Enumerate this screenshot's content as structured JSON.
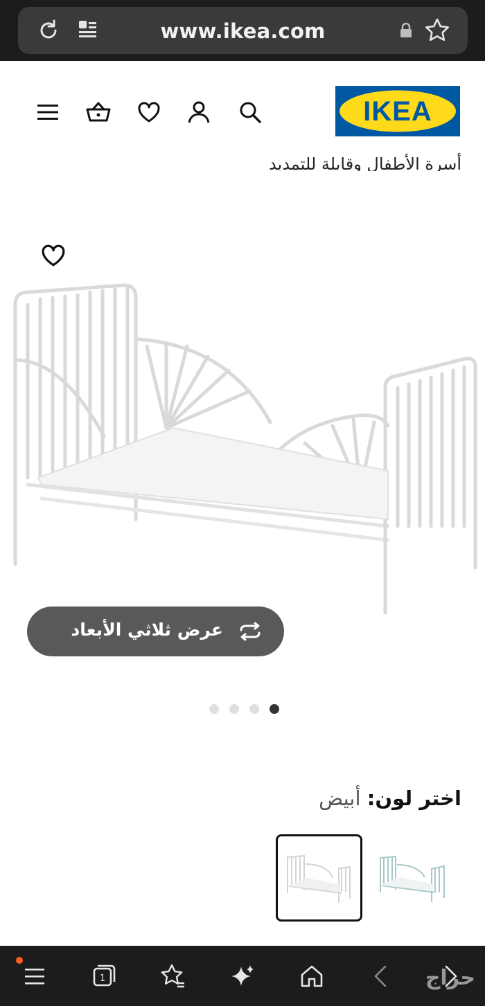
{
  "browser": {
    "url": "www.ikea.com",
    "icons": [
      "reload-icon",
      "reader-mode-icon",
      "lock-icon",
      "bookmark-star-icon"
    ]
  },
  "header": {
    "logo_text": "IKEA",
    "icons": [
      "menu-icon",
      "basket-icon",
      "heart-icon",
      "account-icon",
      "search-icon"
    ],
    "colors": {
      "logo_blue": "#0058a3",
      "logo_yellow": "#ffda1a"
    }
  },
  "product": {
    "title_partial": "أسرة الأطفال وقابلة للتمديد",
    "view_3d_label": "عرض ثلاثي الأبعاد",
    "carousel": {
      "total": 4,
      "active_index": 3
    },
    "color": {
      "label": "اختر لون:",
      "value": "أبيض"
    },
    "swatches": [
      "white",
      "light blue"
    ]
  },
  "bottom_nav": {
    "icons": [
      "menu-icon",
      "tabs-icon",
      "favorites-icon",
      "ai-sparkle-icon",
      "home-icon",
      "back-icon",
      "forward-icon"
    ],
    "tab_count": "1",
    "watermark": "حراج"
  }
}
